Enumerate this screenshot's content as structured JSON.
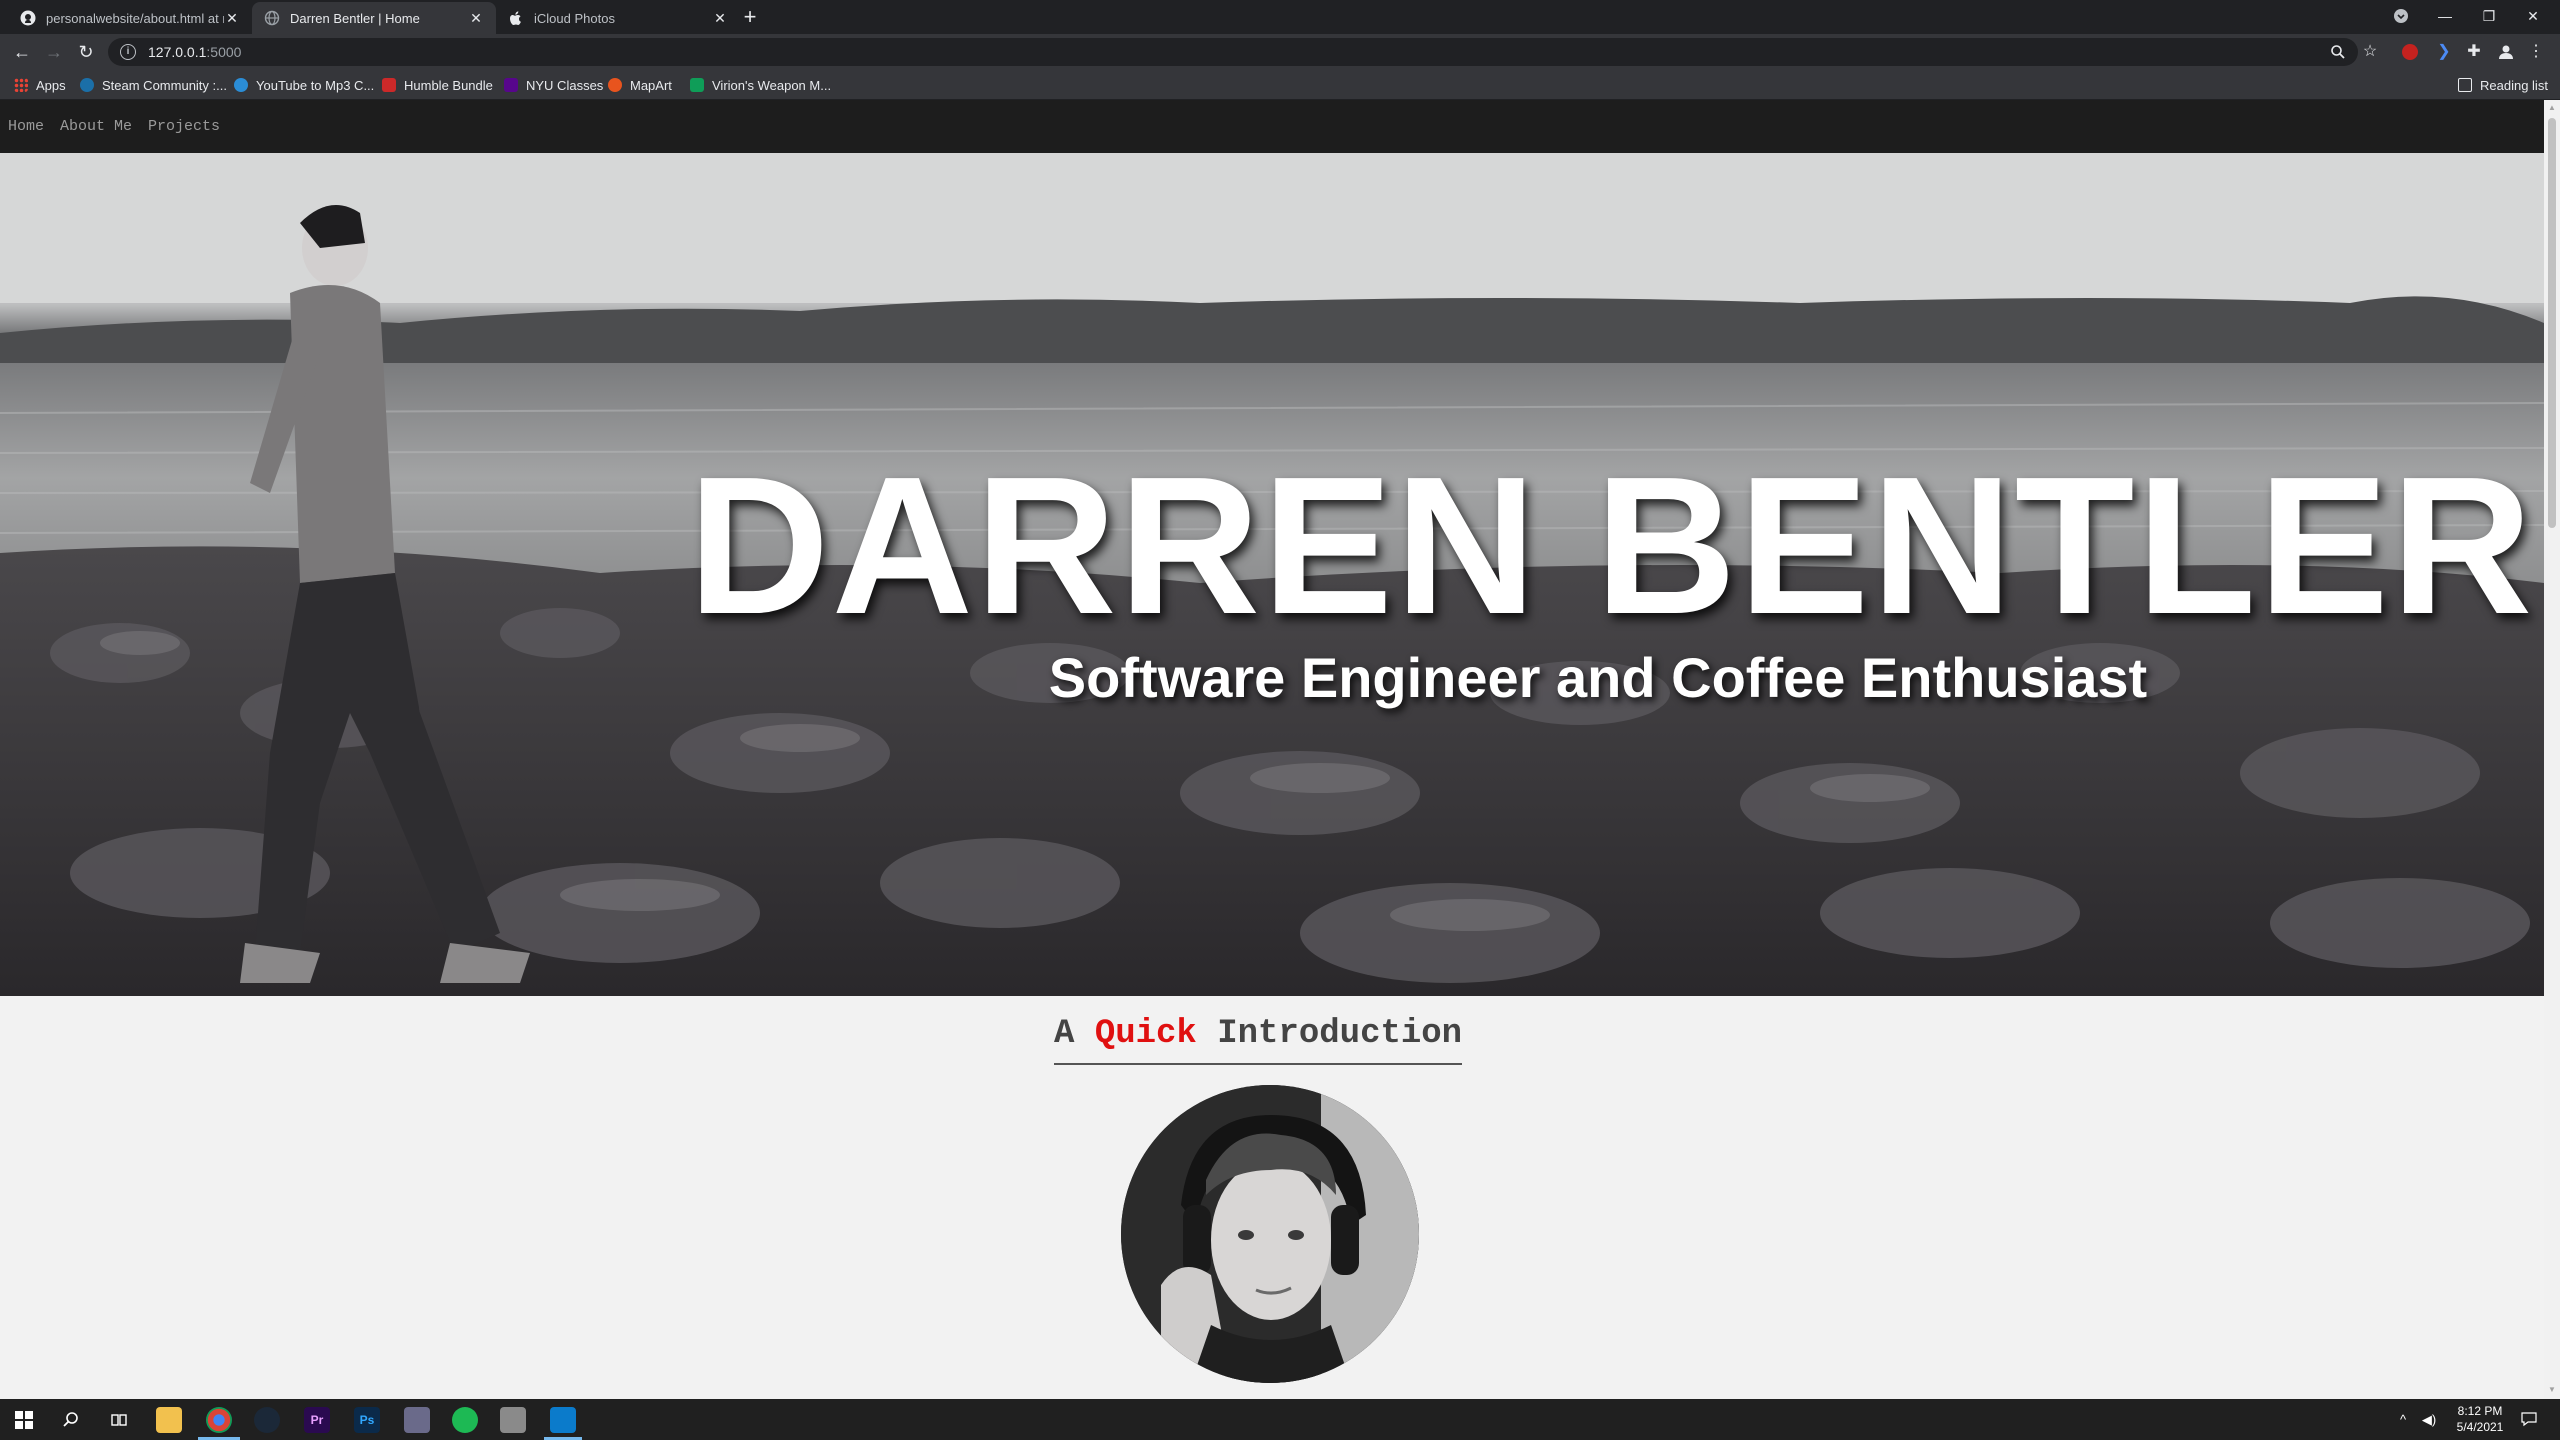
{
  "browser": {
    "tabs": [
      {
        "title": "personalwebsite/about.html at m",
        "favicon": "github-icon",
        "active": false
      },
      {
        "title": "Darren Bentler | Home",
        "favicon": "globe-icon",
        "active": true
      },
      {
        "title": "iCloud Photos",
        "favicon": "apple-icon",
        "active": false
      }
    ],
    "new_tab_label": "+",
    "url_host": "127.0.0.1",
    "url_port": ":5000",
    "reading_list_label": "Reading list",
    "bookmarks": [
      {
        "label": "Apps",
        "icon": "apps-grid-icon",
        "color": "#f4b400"
      },
      {
        "label": "Steam Community :...",
        "icon": "steam-icon",
        "color": "#1b6fa8"
      },
      {
        "label": "YouTube to Mp3 C...",
        "icon": "converter-icon",
        "color": "#2b8dd6"
      },
      {
        "label": "Humble Bundle",
        "icon": "humble-icon",
        "color": "#cc2929"
      },
      {
        "label": "NYU Classes",
        "icon": "nyu-icon",
        "color": "#57068c"
      },
      {
        "label": "MapArt",
        "icon": "mapart-icon",
        "color": "#e8541e"
      },
      {
        "label": "Virion's Weapon M...",
        "icon": "sheets-icon",
        "color": "#0f9d58"
      }
    ]
  },
  "site": {
    "nav": [
      "Home",
      "About Me",
      "Projects"
    ],
    "hero_name": "DARREN BENTLER",
    "hero_tagline": "Software Engineer and Coffee Enthusiast",
    "intro": {
      "prefix": "A",
      "accent": "Quick",
      "suffix": "Introduction"
    }
  },
  "taskbar": {
    "apps": [
      {
        "name": "file-explorer-icon",
        "color": "#f2c14e"
      },
      {
        "name": "chrome-icon",
        "color": "#db4437"
      },
      {
        "name": "steam-icon",
        "color": "#1b2838"
      },
      {
        "name": "premiere-icon",
        "color": "#2a0a50"
      },
      {
        "name": "photoshop-icon",
        "color": "#0b2a4a"
      },
      {
        "name": "mail-icon",
        "color": "#6a6a8a"
      },
      {
        "name": "spotify-icon",
        "color": "#1db954"
      },
      {
        "name": "notes-icon",
        "color": "#8a8a8a"
      },
      {
        "name": "vscode-icon",
        "color": "#0b7bcb"
      }
    ],
    "app_glyphs": [
      "",
      "",
      "",
      "Pr",
      "Ps",
      "",
      "",
      "",
      ""
    ],
    "time": "8:12 PM",
    "date": "5/4/2021"
  },
  "colors": {
    "accent_red": "#e01010",
    "nav_bg": "#1d1d1d"
  }
}
